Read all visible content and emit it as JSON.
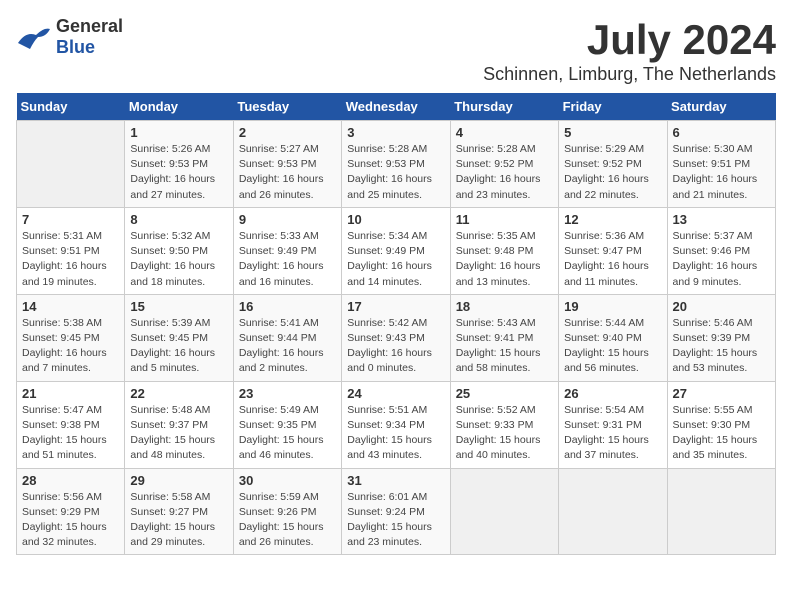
{
  "header": {
    "logo_general": "General",
    "logo_blue": "Blue",
    "title": "July 2024",
    "subtitle": "Schinnen, Limburg, The Netherlands"
  },
  "calendar": {
    "weekdays": [
      "Sunday",
      "Monday",
      "Tuesday",
      "Wednesday",
      "Thursday",
      "Friday",
      "Saturday"
    ],
    "weeks": [
      [
        {
          "day": "",
          "detail": ""
        },
        {
          "day": "1",
          "detail": "Sunrise: 5:26 AM\nSunset: 9:53 PM\nDaylight: 16 hours\nand 27 minutes."
        },
        {
          "day": "2",
          "detail": "Sunrise: 5:27 AM\nSunset: 9:53 PM\nDaylight: 16 hours\nand 26 minutes."
        },
        {
          "day": "3",
          "detail": "Sunrise: 5:28 AM\nSunset: 9:53 PM\nDaylight: 16 hours\nand 25 minutes."
        },
        {
          "day": "4",
          "detail": "Sunrise: 5:28 AM\nSunset: 9:52 PM\nDaylight: 16 hours\nand 23 minutes."
        },
        {
          "day": "5",
          "detail": "Sunrise: 5:29 AM\nSunset: 9:52 PM\nDaylight: 16 hours\nand 22 minutes."
        },
        {
          "day": "6",
          "detail": "Sunrise: 5:30 AM\nSunset: 9:51 PM\nDaylight: 16 hours\nand 21 minutes."
        }
      ],
      [
        {
          "day": "7",
          "detail": "Sunrise: 5:31 AM\nSunset: 9:51 PM\nDaylight: 16 hours\nand 19 minutes."
        },
        {
          "day": "8",
          "detail": "Sunrise: 5:32 AM\nSunset: 9:50 PM\nDaylight: 16 hours\nand 18 minutes."
        },
        {
          "day": "9",
          "detail": "Sunrise: 5:33 AM\nSunset: 9:49 PM\nDaylight: 16 hours\nand 16 minutes."
        },
        {
          "day": "10",
          "detail": "Sunrise: 5:34 AM\nSunset: 9:49 PM\nDaylight: 16 hours\nand 14 minutes."
        },
        {
          "day": "11",
          "detail": "Sunrise: 5:35 AM\nSunset: 9:48 PM\nDaylight: 16 hours\nand 13 minutes."
        },
        {
          "day": "12",
          "detail": "Sunrise: 5:36 AM\nSunset: 9:47 PM\nDaylight: 16 hours\nand 11 minutes."
        },
        {
          "day": "13",
          "detail": "Sunrise: 5:37 AM\nSunset: 9:46 PM\nDaylight: 16 hours\nand 9 minutes."
        }
      ],
      [
        {
          "day": "14",
          "detail": "Sunrise: 5:38 AM\nSunset: 9:45 PM\nDaylight: 16 hours\nand 7 minutes."
        },
        {
          "day": "15",
          "detail": "Sunrise: 5:39 AM\nSunset: 9:45 PM\nDaylight: 16 hours\nand 5 minutes."
        },
        {
          "day": "16",
          "detail": "Sunrise: 5:41 AM\nSunset: 9:44 PM\nDaylight: 16 hours\nand 2 minutes."
        },
        {
          "day": "17",
          "detail": "Sunrise: 5:42 AM\nSunset: 9:43 PM\nDaylight: 16 hours\nand 0 minutes."
        },
        {
          "day": "18",
          "detail": "Sunrise: 5:43 AM\nSunset: 9:41 PM\nDaylight: 15 hours\nand 58 minutes."
        },
        {
          "day": "19",
          "detail": "Sunrise: 5:44 AM\nSunset: 9:40 PM\nDaylight: 15 hours\nand 56 minutes."
        },
        {
          "day": "20",
          "detail": "Sunrise: 5:46 AM\nSunset: 9:39 PM\nDaylight: 15 hours\nand 53 minutes."
        }
      ],
      [
        {
          "day": "21",
          "detail": "Sunrise: 5:47 AM\nSunset: 9:38 PM\nDaylight: 15 hours\nand 51 minutes."
        },
        {
          "day": "22",
          "detail": "Sunrise: 5:48 AM\nSunset: 9:37 PM\nDaylight: 15 hours\nand 48 minutes."
        },
        {
          "day": "23",
          "detail": "Sunrise: 5:49 AM\nSunset: 9:35 PM\nDaylight: 15 hours\nand 46 minutes."
        },
        {
          "day": "24",
          "detail": "Sunrise: 5:51 AM\nSunset: 9:34 PM\nDaylight: 15 hours\nand 43 minutes."
        },
        {
          "day": "25",
          "detail": "Sunrise: 5:52 AM\nSunset: 9:33 PM\nDaylight: 15 hours\nand 40 minutes."
        },
        {
          "day": "26",
          "detail": "Sunrise: 5:54 AM\nSunset: 9:31 PM\nDaylight: 15 hours\nand 37 minutes."
        },
        {
          "day": "27",
          "detail": "Sunrise: 5:55 AM\nSunset: 9:30 PM\nDaylight: 15 hours\nand 35 minutes."
        }
      ],
      [
        {
          "day": "28",
          "detail": "Sunrise: 5:56 AM\nSunset: 9:29 PM\nDaylight: 15 hours\nand 32 minutes."
        },
        {
          "day": "29",
          "detail": "Sunrise: 5:58 AM\nSunset: 9:27 PM\nDaylight: 15 hours\nand 29 minutes."
        },
        {
          "day": "30",
          "detail": "Sunrise: 5:59 AM\nSunset: 9:26 PM\nDaylight: 15 hours\nand 26 minutes."
        },
        {
          "day": "31",
          "detail": "Sunrise: 6:01 AM\nSunset: 9:24 PM\nDaylight: 15 hours\nand 23 minutes."
        },
        {
          "day": "",
          "detail": ""
        },
        {
          "day": "",
          "detail": ""
        },
        {
          "day": "",
          "detail": ""
        }
      ]
    ]
  }
}
